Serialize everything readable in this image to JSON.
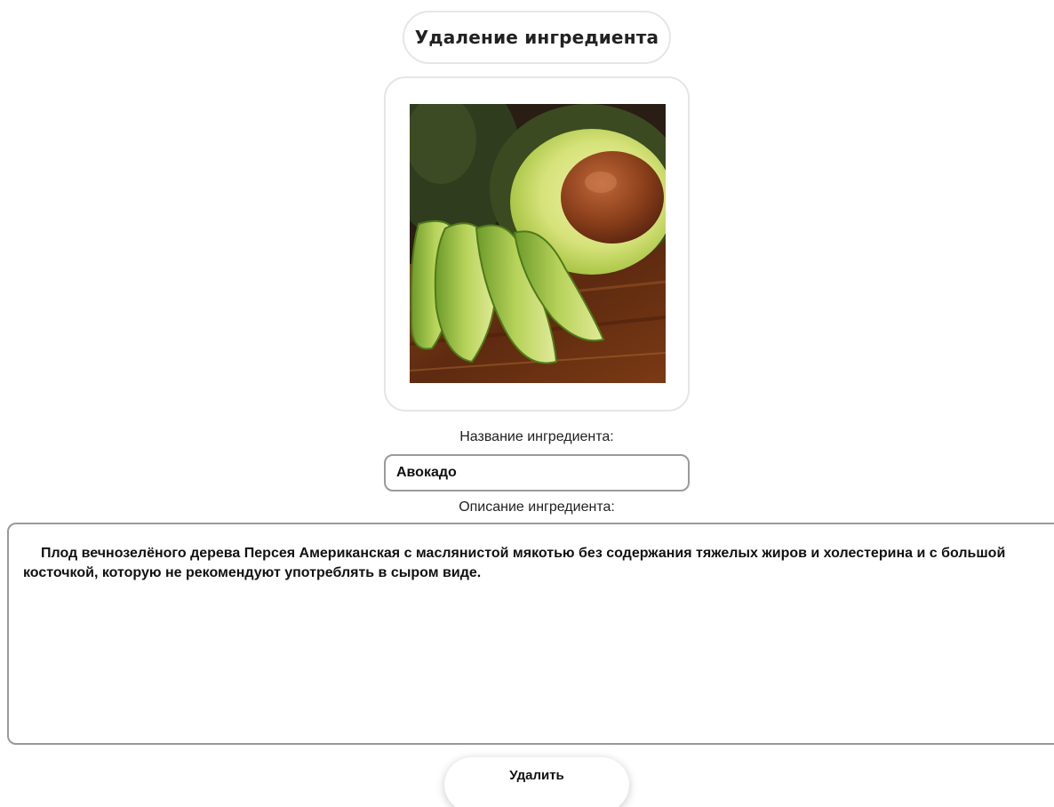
{
  "header": {
    "title": "Удаление ингредиента"
  },
  "image": {
    "subject": "avocado-photo"
  },
  "form": {
    "name_label": "Название ингредиента:",
    "name_value": "Авокадо",
    "description_label": "Описание ингредиента:",
    "description_value": "Плод вечнозелёного дерева Персея Американская с маслянистой мякотью без содержания тяжелых жиров и холестерина и с большой косточкой, которую не рекомендуют употреблять в сыром виде."
  },
  "actions": {
    "delete_label": "Удалить"
  },
  "colors": {
    "border_light": "#e6e6e6",
    "border_input": "#9a9a9a",
    "avocado_flesh": "#c9dc6a",
    "avocado_skin": "#2c3a1c",
    "pit": "#7a3b17",
    "board": "#6b3416"
  }
}
